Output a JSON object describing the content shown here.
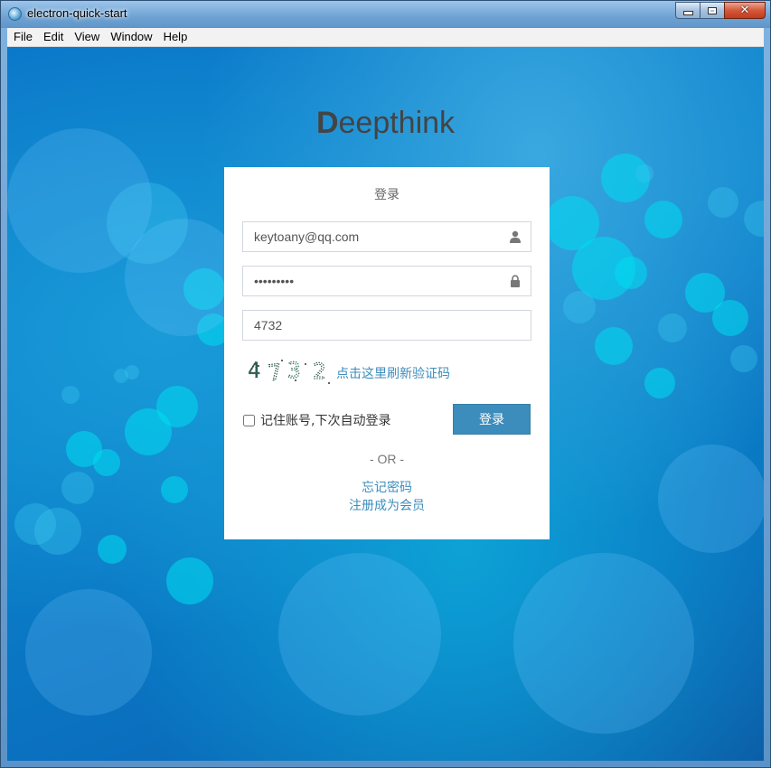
{
  "window": {
    "title": "electron-quick-start",
    "controls": {
      "minimize": "minimize",
      "maximize": "maximize",
      "close": "close"
    }
  },
  "menubar": {
    "items": [
      {
        "label": "File"
      },
      {
        "label": "Edit"
      },
      {
        "label": "View"
      },
      {
        "label": "Window"
      },
      {
        "label": "Help"
      }
    ]
  },
  "brand": {
    "first_letter": "D",
    "rest": "eepthink"
  },
  "login": {
    "title": "登录",
    "username": {
      "value": "keytoany@qq.com",
      "icon": "user-icon"
    },
    "password": {
      "value": "•••••••••",
      "icon": "lock-icon"
    },
    "captcha_input": {
      "value": "4732"
    },
    "captcha_image_text": "4732",
    "captcha_refresh_label": "点击这里刷新验证码",
    "remember_label": "记住账号,下次自动登录",
    "remember_checked": false,
    "submit_label": "登录",
    "or_label": "- OR -",
    "forgot_label": "忘记密码",
    "register_label": "注册成为会员"
  },
  "colors": {
    "accent": "#3c8dbc",
    "background": "#0a83cc",
    "brand_text": "#444444"
  }
}
